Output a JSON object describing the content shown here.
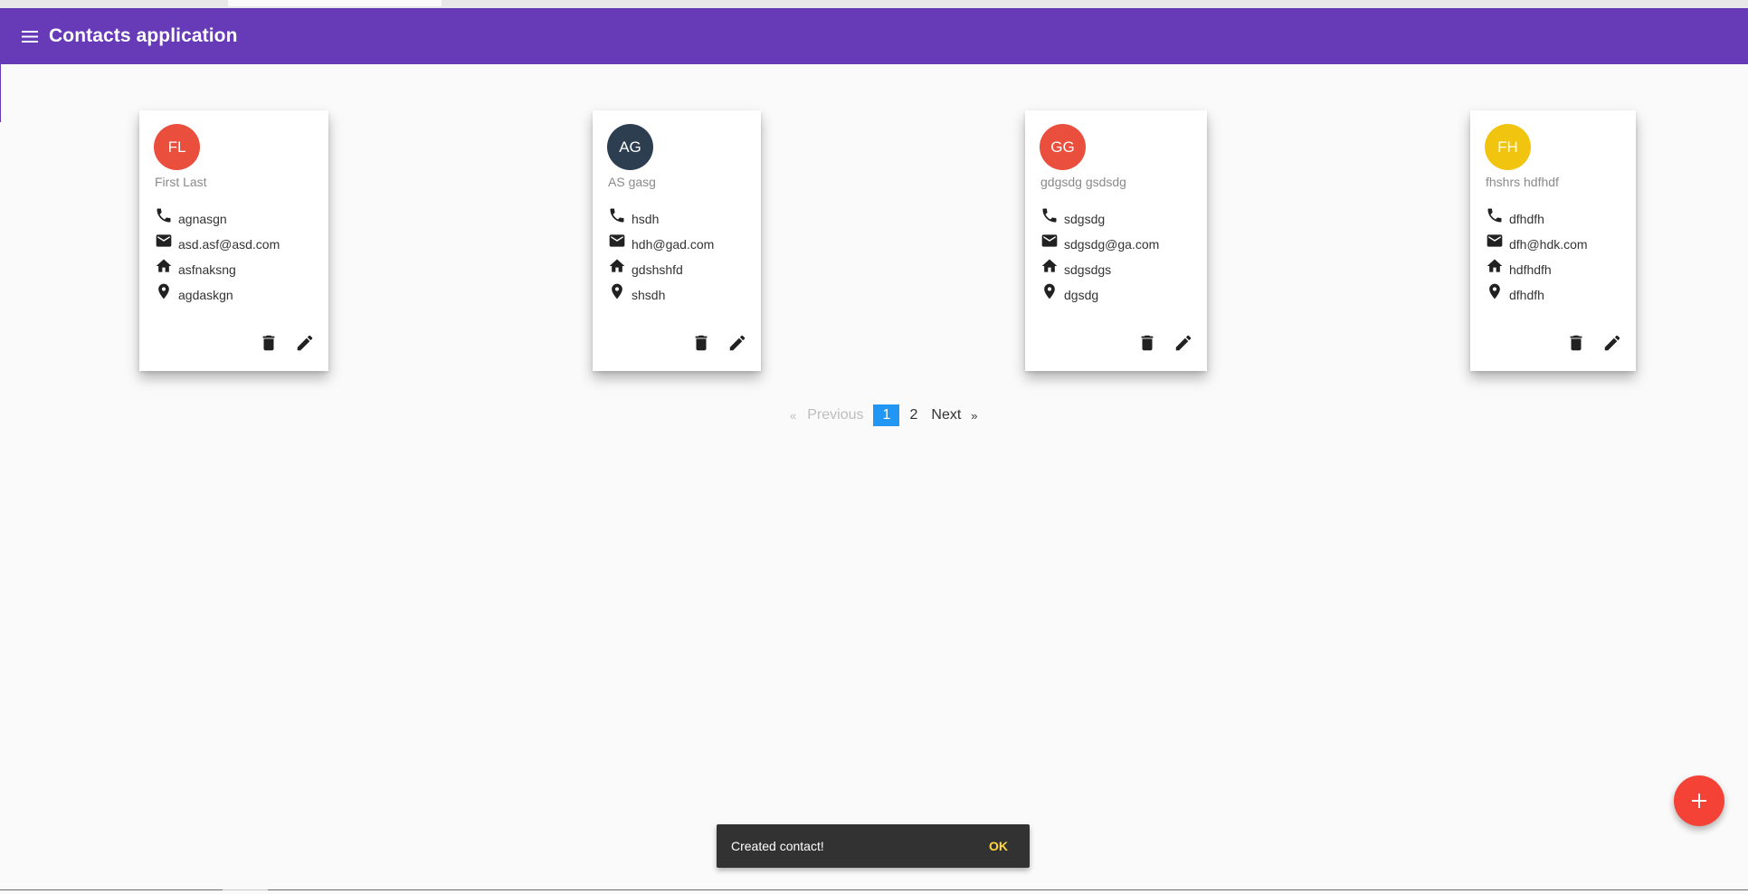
{
  "header": {
    "title": "Contacts application",
    "menu_icon": "menu-icon",
    "color": "#673ab7"
  },
  "contacts": [
    {
      "initials": "FL",
      "name": "First Last",
      "avatar_color": "#ea4e3d",
      "phone": "agnasgn",
      "email": "asd.asf@asd.com",
      "address": "asfnaksng",
      "location": "agdaskgn"
    },
    {
      "initials": "AG",
      "name": "AS gasg",
      "avatar_color": "#2c3e50",
      "phone": "hsdh",
      "email": "hdh@gad.com",
      "address": "gdshshfd",
      "location": "shsdh"
    },
    {
      "initials": "GG",
      "name": "gdgsdg gsdsdg",
      "avatar_color": "#ea4e3d",
      "phone": "sdgsdg",
      "email": "sdgsdg@ga.com",
      "address": "sdgsdgs",
      "location": "dgsdg"
    },
    {
      "initials": "FH",
      "name": "fhshrs hdfhdf",
      "avatar_color": "#f1c40f",
      "phone": "dfhdfh",
      "email": "dfh@hdk.com",
      "address": "hdfhdfh",
      "location": "dfhdfh"
    }
  ],
  "pagination": {
    "prev_arrow": "«",
    "previous": "Previous",
    "pages": [
      "1",
      "2"
    ],
    "current": "1",
    "next": "Next",
    "next_arrow": "»",
    "active_color": "#2196f3"
  },
  "fab": {
    "icon": "plus-icon",
    "color": "#f44336"
  },
  "snackbar": {
    "message": "Created contact!",
    "action": "OK"
  }
}
